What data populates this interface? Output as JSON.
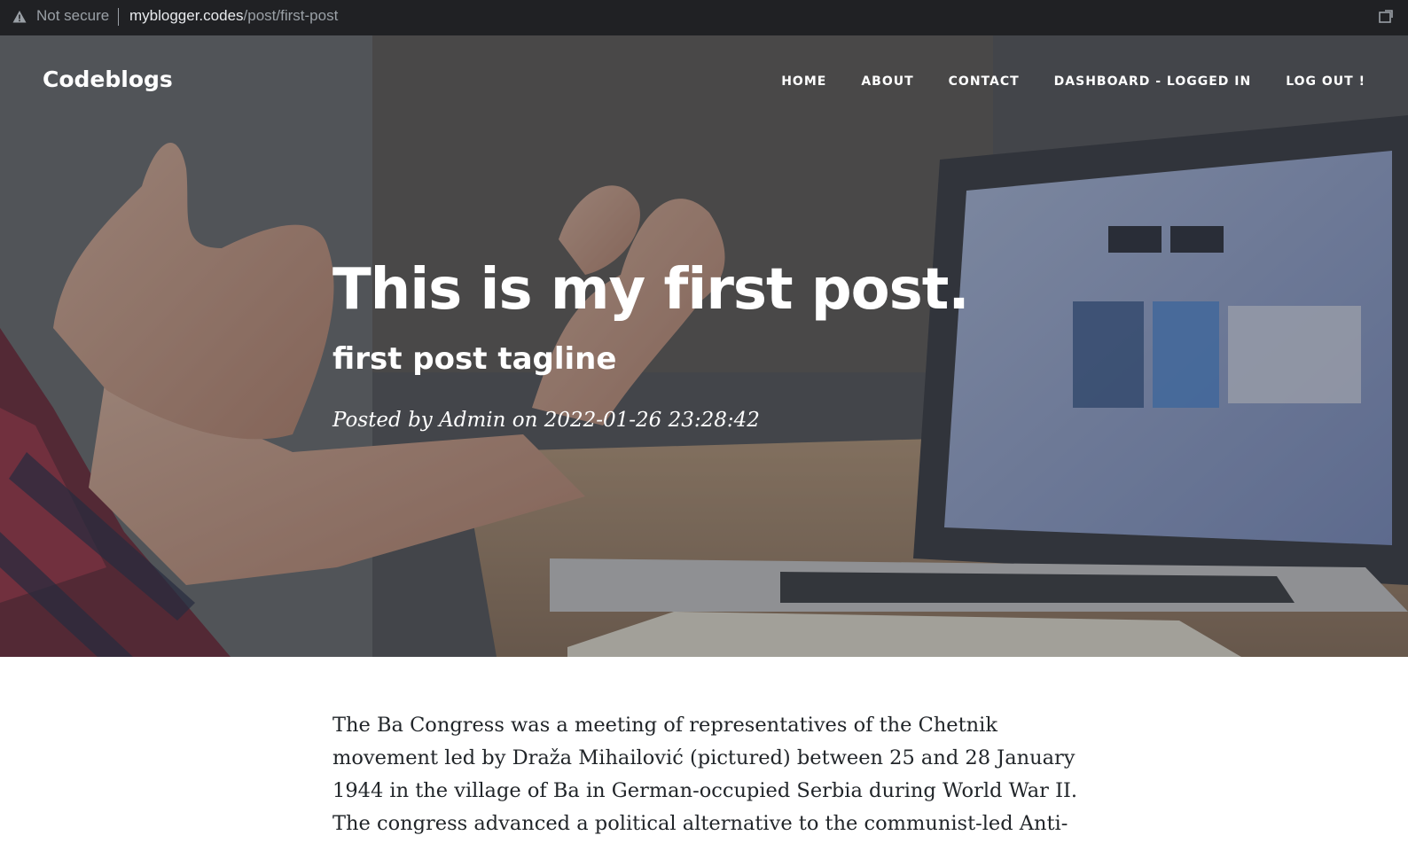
{
  "browser": {
    "security_label": "Not secure",
    "url_domain": "myblogger.codes",
    "url_path": "/post/first-post"
  },
  "site": {
    "brand": "Codeblogs",
    "nav": [
      {
        "label": "HOME"
      },
      {
        "label": "ABOUT"
      },
      {
        "label": "CONTACT"
      },
      {
        "label": "DASHBOARD - LOGGED IN"
      },
      {
        "label": "LOG OUT !"
      }
    ]
  },
  "post": {
    "title": "This is my first post.",
    "tagline": "first post tagline",
    "meta": "Posted by Admin on 2022-01-26 23:28:42",
    "body": "The Ba Congress was a meeting of representatives of the Chetnik movement led by Draža Mihailović (pictured) between 25 and 28 January 1944 in the village of Ba in German-occupied Serbia during World War II. The congress advanced a political alternative to the communist-led Anti-"
  },
  "colors": {
    "addressbar_bg": "#202124",
    "text_dark": "#212529",
    "hero_text": "#ffffff"
  }
}
